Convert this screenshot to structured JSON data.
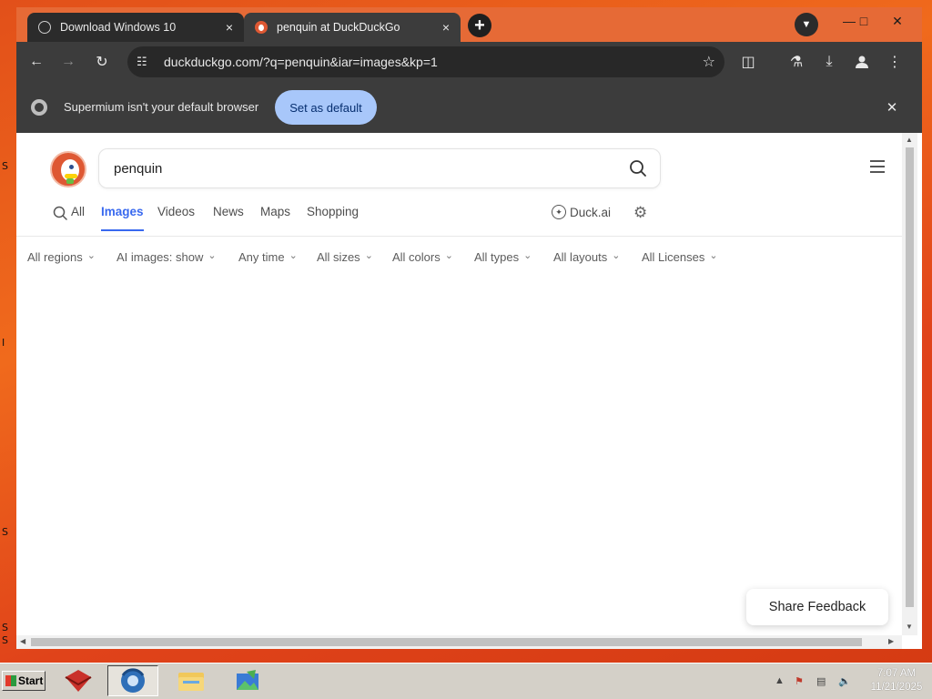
{
  "desktop": {
    "glyphs": [
      "S",
      "I",
      "S",
      "S",
      "S"
    ]
  },
  "browser": {
    "tabs": [
      {
        "title": "Download Windows 10",
        "favicon": "globe-icon",
        "active": false
      },
      {
        "title": "penquin at DuckDuckGo",
        "favicon": "duckduckgo-icon",
        "active": true
      }
    ],
    "close_glyph": "×",
    "new_tab_glyph": "+",
    "url": "duckduckgo.com/?q=penquin&iar=images&kp=1",
    "infobar": {
      "message": "Supermium isn't your default browser",
      "button_label": "Set as default"
    }
  },
  "page": {
    "query": "penquin",
    "nav_tabs": [
      "All",
      "Images",
      "Videos",
      "News",
      "Maps",
      "Shopping"
    ],
    "active_tab": "Images",
    "duck_ai_label": "Duck.ai",
    "filters": [
      "All regions",
      "AI images: show",
      "Any time",
      "All sizes",
      "All colors",
      "All types",
      "All layouts",
      "All Licenses"
    ],
    "feedback_label": "Share Feedback"
  },
  "taskbar": {
    "start_label": "Start",
    "apps": [
      "winrar-icon",
      "supermium-browser-icon",
      "file-explorer-icon",
      "image-viewer-icon"
    ],
    "time": "7:07 AM",
    "date": "11/21/2025"
  },
  "colors": {
    "accent": "#3969ef",
    "ddg_orange": "#de5833",
    "set_default_bg": "#a8c7fa",
    "tabstrip": "#e66a36"
  }
}
